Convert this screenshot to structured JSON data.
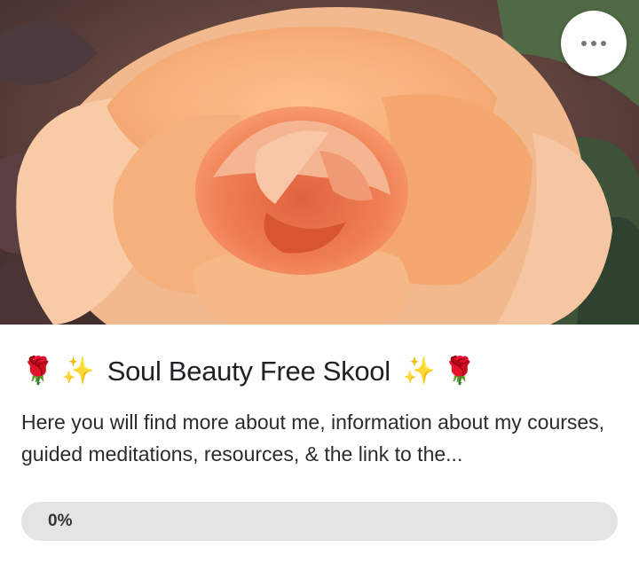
{
  "course": {
    "title_prefix_icons": [
      "rose-emoji",
      "sparkles-emoji"
    ],
    "title": "Soul Beauty Free Skool",
    "title_suffix_icons": [
      "sparkles-emoji",
      "rose-emoji"
    ],
    "description": "Here you will find more about me, information about my courses, guided meditations, resources, & the link to the...",
    "progress_label": "0%",
    "progress_fraction": 0.0,
    "cover_image": "peach-rose-photo",
    "more_button_icon": "more-horizontal-icon"
  },
  "colors": {
    "rose_petal": "#f5a872",
    "progress_track": "#e4e4e4",
    "text": "#202124"
  }
}
